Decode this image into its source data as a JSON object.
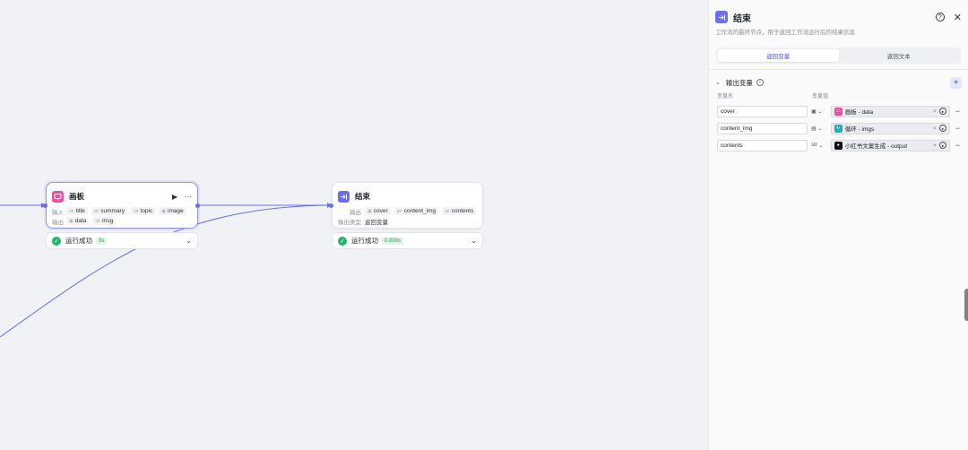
{
  "colors": {
    "accent": "#6a6ff0",
    "canvas_bg": "#f1f2f5",
    "success": "#24b36a",
    "drawing_board": "#ef4da0"
  },
  "nodes": {
    "huaban": {
      "icon": "drawing-board-icon",
      "title": "画板",
      "input_label": "输入",
      "inputs": [
        {
          "type": "str",
          "name": "title"
        },
        {
          "type": "str",
          "name": "summary"
        },
        {
          "type": "str",
          "name": "topic"
        },
        {
          "type": "img",
          "name": "image"
        }
      ],
      "output_label": "输出",
      "outputs": [
        {
          "type": "img",
          "name": "data"
        },
        {
          "type": "str",
          "name": "msg"
        }
      ],
      "status": "运行成功",
      "time": "3s"
    },
    "end": {
      "icon": "exit-icon",
      "title": "结束",
      "output_label": "输出",
      "outputs": [
        {
          "type": "img",
          "name": "cover"
        },
        {
          "type": "arr",
          "name": "content_img"
        },
        {
          "type": "str",
          "name": "contents"
        }
      ],
      "output_type_label": "输出类型",
      "output_type_value": "返回变量",
      "status": "运行成功",
      "time": "0.000s"
    }
  },
  "panel": {
    "title": "结束",
    "description": "工作流的最终节点，用于返回工作流运行后的结果信息",
    "tabs": [
      "返回变量",
      "返回文本"
    ],
    "active_tab": 0,
    "section_title": "输出变量",
    "col_name": "变量名",
    "col_value": "变量值",
    "rows": [
      {
        "name": "cover",
        "type": "img",
        "source_icon": "drawing-board-icon",
        "source_color": "#ef4da0",
        "source": "画板 - data"
      },
      {
        "name": "content_img",
        "type": "arr",
        "source_icon": "loop-icon",
        "source_color": "#16b5b8",
        "source": "循环 - imgs"
      },
      {
        "name": "contents",
        "type": "str",
        "source_icon": "bot-icon",
        "source_color": "#111111",
        "source": "小红书文案生成 - output"
      }
    ]
  }
}
